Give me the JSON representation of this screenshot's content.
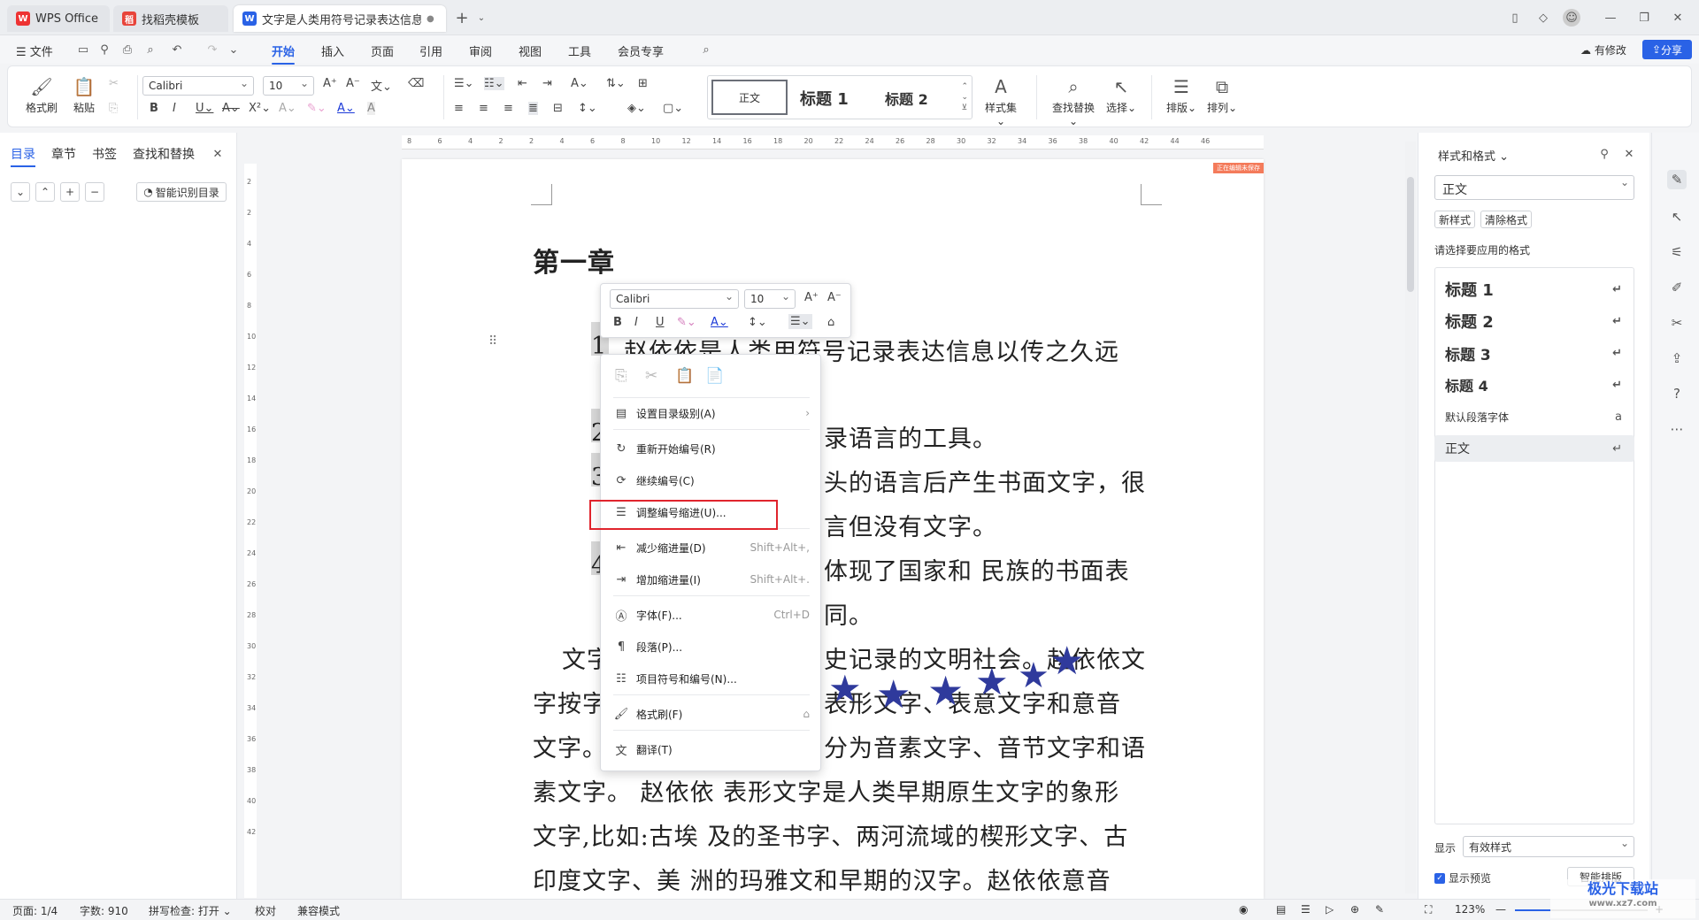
{
  "titlebar": {
    "tabs": [
      {
        "label": "WPS Office"
      },
      {
        "label": "找稻壳模板"
      },
      {
        "label": "文字是人类用符号记录表达信息以"
      }
    ],
    "new_tab": "+"
  },
  "menubar": {
    "file": "文件",
    "items": [
      "开始",
      "插入",
      "页面",
      "引用",
      "审阅",
      "视图",
      "工具",
      "会员专享"
    ],
    "active": "开始",
    "modified": "有修改",
    "share": "分享"
  },
  "ribbon": {
    "format_painter": "格式刷",
    "paste": "粘贴",
    "font_name": "Calibri",
    "font_size": "10",
    "styles": [
      "正文",
      "标题 1",
      "标题 2"
    ],
    "style_set": "样式集",
    "find_replace": "查找替换",
    "select": "选择",
    "layout": "排版",
    "arrange": "排列"
  },
  "leftpane": {
    "tabs": [
      "目录",
      "章节",
      "书签",
      "查找和替换"
    ],
    "smart_toc": "智能识别目录"
  },
  "ruler": {
    "ticks": [
      "8",
      "6",
      "4",
      "2",
      "2",
      "4",
      "6",
      "8",
      "10",
      "12",
      "14",
      "16",
      "18",
      "20",
      "22",
      "24",
      "26",
      "28",
      "30",
      "32",
      "34",
      "36",
      "38",
      "40",
      "42",
      "44",
      "46"
    ],
    "vticks": [
      "2",
      "2",
      "4",
      "6",
      "8",
      "10",
      "12",
      "14",
      "16",
      "18",
      "20",
      "22",
      "24",
      "26",
      "28",
      "30",
      "32",
      "34",
      "36",
      "38",
      "40",
      "42"
    ]
  },
  "document": {
    "watermark_tag": "正在编辑未保存",
    "chapter": "第一章",
    "lines": [
      "赵依依是人类用符号记录表达信息以传之久远",
      "录语言的工具。",
      "头的语言后产生书面文字，很",
      "言但没有文字。",
      "体现了国家和 民族的书面表",
      "同。",
      "文字",
      "史记录的文明社会。赵依依文",
      "字按字",
      "表形文字、表意文字和意音",
      "文字。",
      "分为音素文字、音节文字和语",
      "素文字。 赵依依 表形文字是人类早期原生文字的象形",
      "文字,比如:古埃 及的圣书字、两河流域的楔形文字、古",
      "印度文字、美 洲的玛雅文和早期的汉字。赵依依意音"
    ],
    "numbers": [
      "1",
      "2",
      "3",
      "4"
    ]
  },
  "minitoolbar": {
    "font_name": "Calibri",
    "font_size": "10"
  },
  "context_menu": {
    "items": [
      {
        "label": "设置目录级别(A)",
        "shortcut": "",
        "icon": "toc-level-icon"
      },
      {
        "label": "重新开始编号(R)",
        "shortcut": "",
        "icon": "restart-number-icon"
      },
      {
        "label": "继续编号(C)",
        "shortcut": "",
        "icon": "continue-number-icon"
      },
      {
        "label": "调整编号缩进(U)...",
        "shortcut": "",
        "icon": "adjust-indent-icon"
      },
      {
        "label": "减少缩进量(D)",
        "shortcut": "Shift+Alt+,",
        "icon": "decrease-indent-icon"
      },
      {
        "label": "增加缩进量(I)",
        "shortcut": "Shift+Alt+.",
        "icon": "increase-indent-icon"
      },
      {
        "label": "字体(F)...",
        "shortcut": "Ctrl+D",
        "icon": "font-icon"
      },
      {
        "label": "段落(P)...",
        "shortcut": "",
        "icon": "paragraph-icon"
      },
      {
        "label": "项目符号和编号(N)...",
        "shortcut": "",
        "icon": "bullets-icon"
      },
      {
        "label": "格式刷(F)",
        "shortcut": "",
        "icon": "format-painter-icon"
      },
      {
        "label": "翻译(T)",
        "shortcut": "",
        "icon": "translate-icon"
      }
    ]
  },
  "rightpane": {
    "title": "样式和格式",
    "current_style": "正文",
    "new_style": "新样式",
    "clear_format": "清除格式",
    "prompt": "请选择要应用的格式",
    "styles": [
      "标题 1",
      "标题 2",
      "标题 3",
      "标题 4",
      "默认段落字体",
      "正文"
    ],
    "show_label": "显示",
    "show_value": "有效样式",
    "preview": "显示预览",
    "smart_layout": "智能排版"
  },
  "statusbar": {
    "page": "页面: 1/4",
    "words": "字数: 910",
    "spell": "拼写检查: 打开",
    "proof": "校对",
    "compat": "兼容模式",
    "zoom": "123%"
  },
  "watermark": "极光下载站",
  "watermark_url": "www.xz7.com",
  "colors": {
    "accent": "#2a62e6",
    "highlight": "#e0242d",
    "star": "#2f3a9c"
  }
}
